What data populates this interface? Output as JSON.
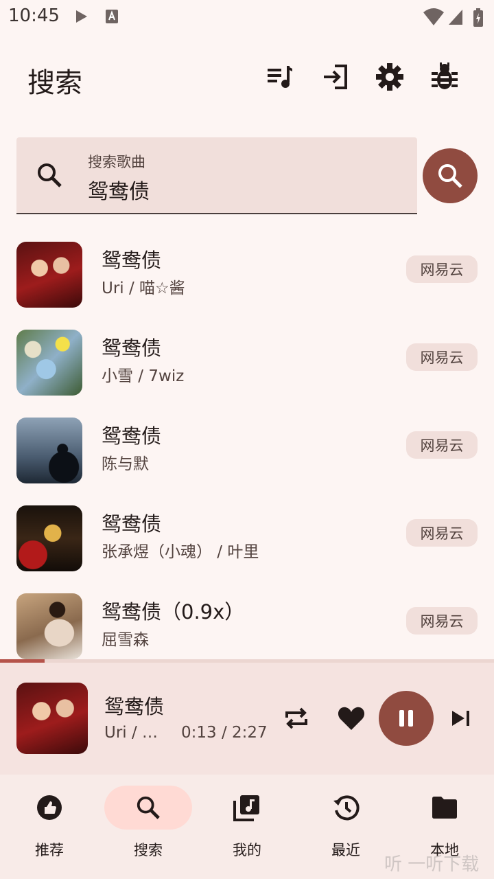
{
  "status_bar": {
    "time": "10:45"
  },
  "header": {
    "title": "搜索"
  },
  "search": {
    "label": "搜索歌曲",
    "value": "鸳鸯债"
  },
  "results": [
    {
      "title": "鸳鸯债",
      "artist": "Uri / 喵☆酱",
      "source": "网易云"
    },
    {
      "title": "鸳鸯债",
      "artist": "小雪 / 7wiz",
      "source": "网易云"
    },
    {
      "title": "鸳鸯债",
      "artist": "陈与默",
      "source": "网易云"
    },
    {
      "title": "鸳鸯债",
      "artist": "张承煜（小魂） / 叶里",
      "source": "网易云"
    },
    {
      "title": "鸳鸯债（0.9x）",
      "artist": "屈雪森",
      "source": "网易云"
    }
  ],
  "player": {
    "title": "鸳鸯债",
    "artist": "Uri / …",
    "time": "0:13 / 2:27",
    "progress": 0.09
  },
  "nav": [
    {
      "label": "推荐"
    },
    {
      "label": "搜索",
      "active": true
    },
    {
      "label": "我的"
    },
    {
      "label": "最近"
    },
    {
      "label": "本地"
    }
  ],
  "watermark": "听 一听下载",
  "colors": {
    "accent": "#904b40",
    "background": "#fdf5f3",
    "search_bg": "#f1dfdb",
    "player_bg": "#f5e3e0",
    "nav_active": "#ffdad4"
  }
}
